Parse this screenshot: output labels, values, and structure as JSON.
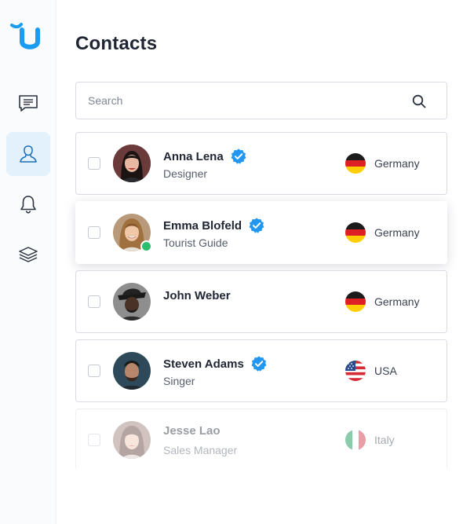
{
  "app": {
    "logo_icon": "brand-u-icon",
    "accent_color": "#1a9cf0"
  },
  "sidebar": {
    "items": [
      {
        "icon": "chat-icon",
        "active": false
      },
      {
        "icon": "contacts-icon",
        "active": true
      },
      {
        "icon": "bell-icon",
        "active": false
      },
      {
        "icon": "layers-icon",
        "active": false
      }
    ]
  },
  "page": {
    "title": "Contacts"
  },
  "search": {
    "placeholder": "Search",
    "value": "",
    "icon": "search-icon"
  },
  "contacts": [
    {
      "name": "Anna Lena",
      "role": "Designer",
      "verified": true,
      "online": false,
      "country": "Germany",
      "flag": "germany-flag-icon"
    },
    {
      "name": "Emma Blofeld",
      "role": "Tourist Guide",
      "verified": true,
      "online": true,
      "country": "Germany",
      "flag": "germany-flag-icon"
    },
    {
      "name": "John Weber",
      "role": "",
      "verified": false,
      "online": false,
      "country": "Germany",
      "flag": "germany-flag-icon"
    },
    {
      "name": "Steven Adams",
      "role": "Singer",
      "verified": true,
      "online": false,
      "country": "USA",
      "flag": "usa-flag-icon"
    },
    {
      "name": "Jesse Lao",
      "role": "Sales Manager",
      "verified": false,
      "online": false,
      "country": "Italy",
      "flag": "italy-flag-icon"
    }
  ],
  "colors": {
    "verified": "#2196f3",
    "online": "#2dbd6e",
    "active_nav_bg": "#e3f1fc"
  }
}
